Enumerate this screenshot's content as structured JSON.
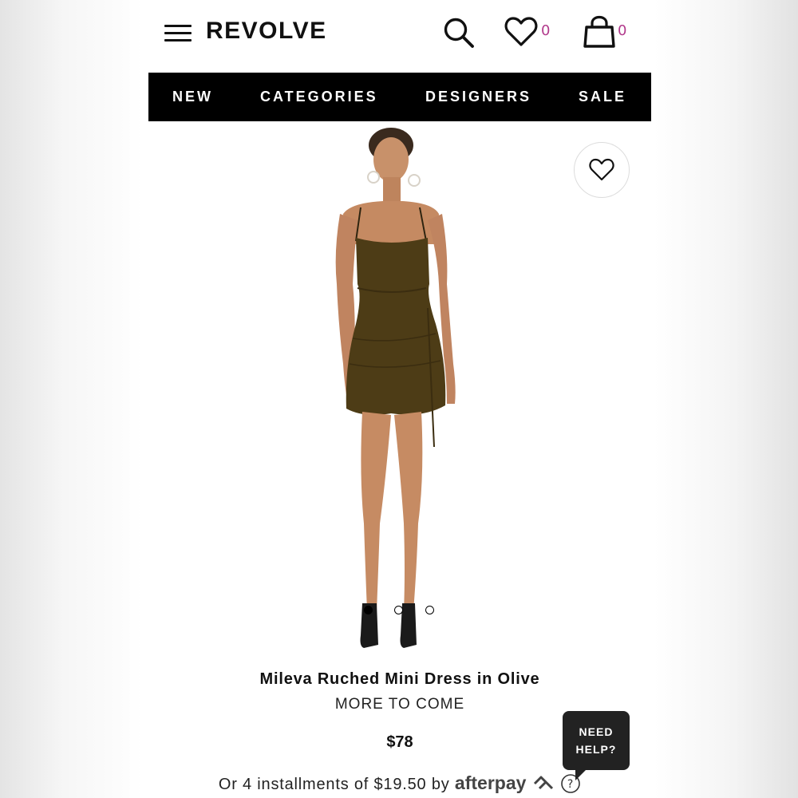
{
  "header": {
    "logo": "REVOLVE",
    "wishlist_count": "0",
    "bag_count": "0"
  },
  "nav": {
    "items": [
      "NEW",
      "CATEGORIES",
      "DESIGNERS",
      "SALE"
    ]
  },
  "product": {
    "name": "Mileva Ruched Mini Dress in Olive",
    "brand": "MORE TO COME",
    "price": "$78",
    "installments_text": "Or 4 installments of $19.50 by",
    "afterpay_logo": "afterpay",
    "carousel": {
      "slides": 3,
      "active_index": 0
    }
  },
  "help": {
    "line1": "NEED",
    "line2": "HELP?"
  },
  "colors": {
    "nav_background": "#000000",
    "badge_count": "#b23a8c",
    "dress_olive": "#4d3c16",
    "help_background": "#222222"
  }
}
